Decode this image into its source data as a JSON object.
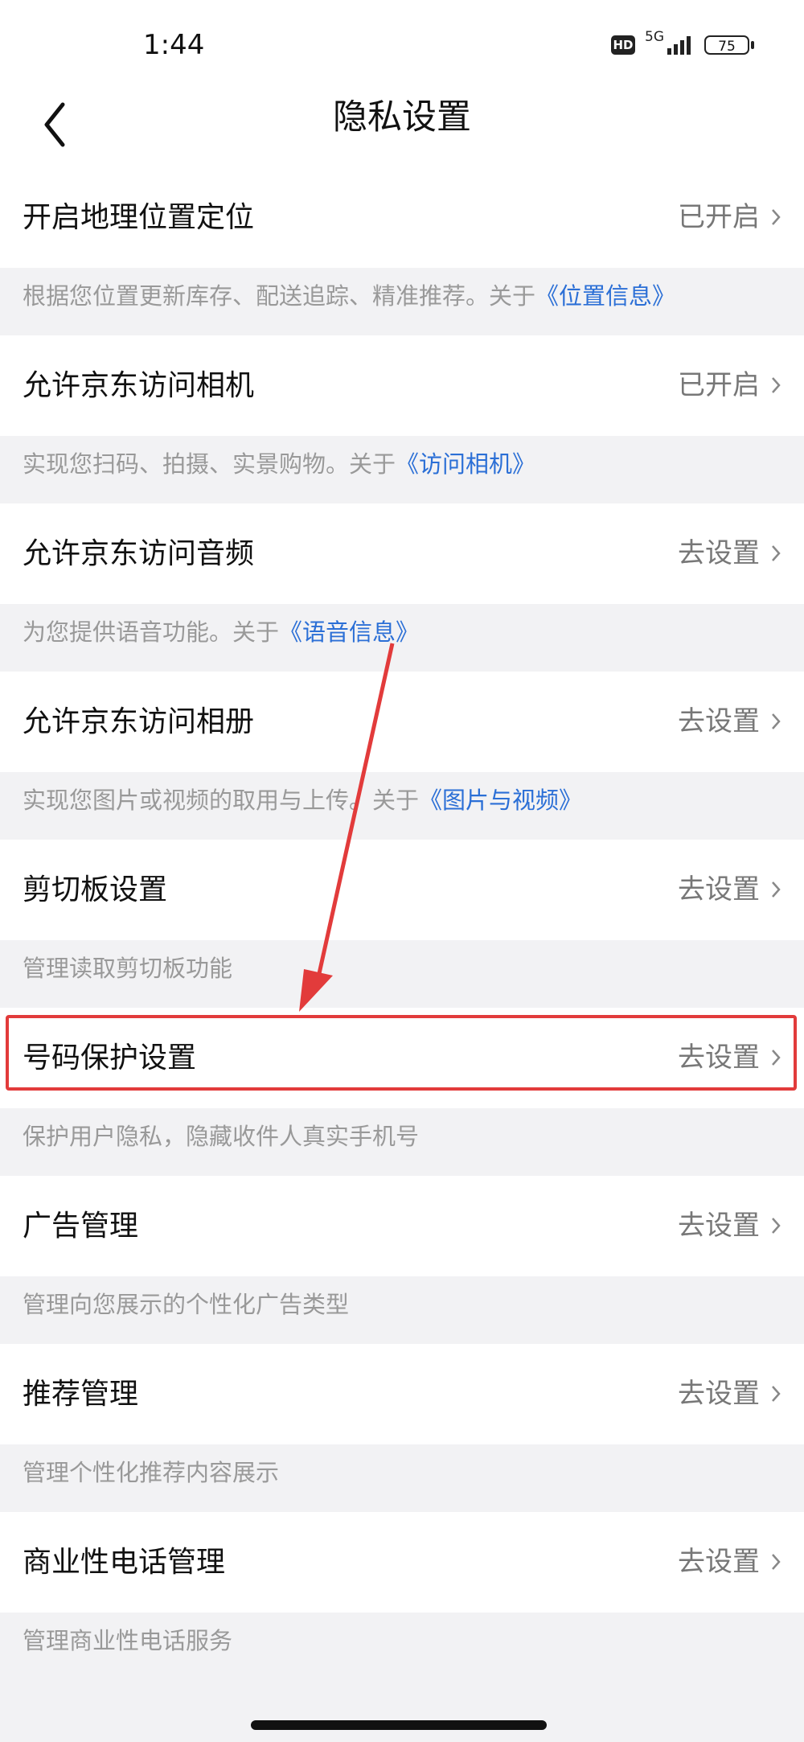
{
  "status_bar": {
    "time": "1:44",
    "hd_badge": "HD",
    "network": "5G",
    "battery": "75"
  },
  "header": {
    "title": "隐私设置"
  },
  "settings": [
    {
      "label": "开启地理位置定位",
      "value": "已开启",
      "desc": "根据您位置更新库存、配送追踪、精准推荐。关于",
      "link": "《位置信息》"
    },
    {
      "label": "允许京东访问相机",
      "value": "已开启",
      "desc": "实现您扫码、拍摄、实景购物。关于",
      "link": "《访问相机》"
    },
    {
      "label": "允许京东访问音频",
      "value": "去设置",
      "desc": "为您提供语音功能。关于",
      "link": "《语音信息》"
    },
    {
      "label": "允许京东访问相册",
      "value": "去设置",
      "desc": "实现您图片或视频的取用与上传。关于",
      "link": "《图片与视频》"
    },
    {
      "label": "剪切板设置",
      "value": "去设置",
      "desc": "管理读取剪切板功能",
      "link": ""
    },
    {
      "label": "号码保护设置",
      "value": "去设置",
      "desc": "保护用户隐私，隐藏收件人真实手机号",
      "link": ""
    },
    {
      "label": "广告管理",
      "value": "去设置",
      "desc": "管理向您展示的个性化广告类型",
      "link": ""
    },
    {
      "label": "推荐管理",
      "value": "去设置",
      "desc": "管理个性化推荐内容展示",
      "link": ""
    },
    {
      "label": "商业性电话管理",
      "value": "去设置",
      "desc": "管理商业性电话服务",
      "link": ""
    }
  ],
  "colors": {
    "link": "#2b6fd6",
    "highlight": "#e23b3b",
    "background": "#f2f2f4"
  }
}
